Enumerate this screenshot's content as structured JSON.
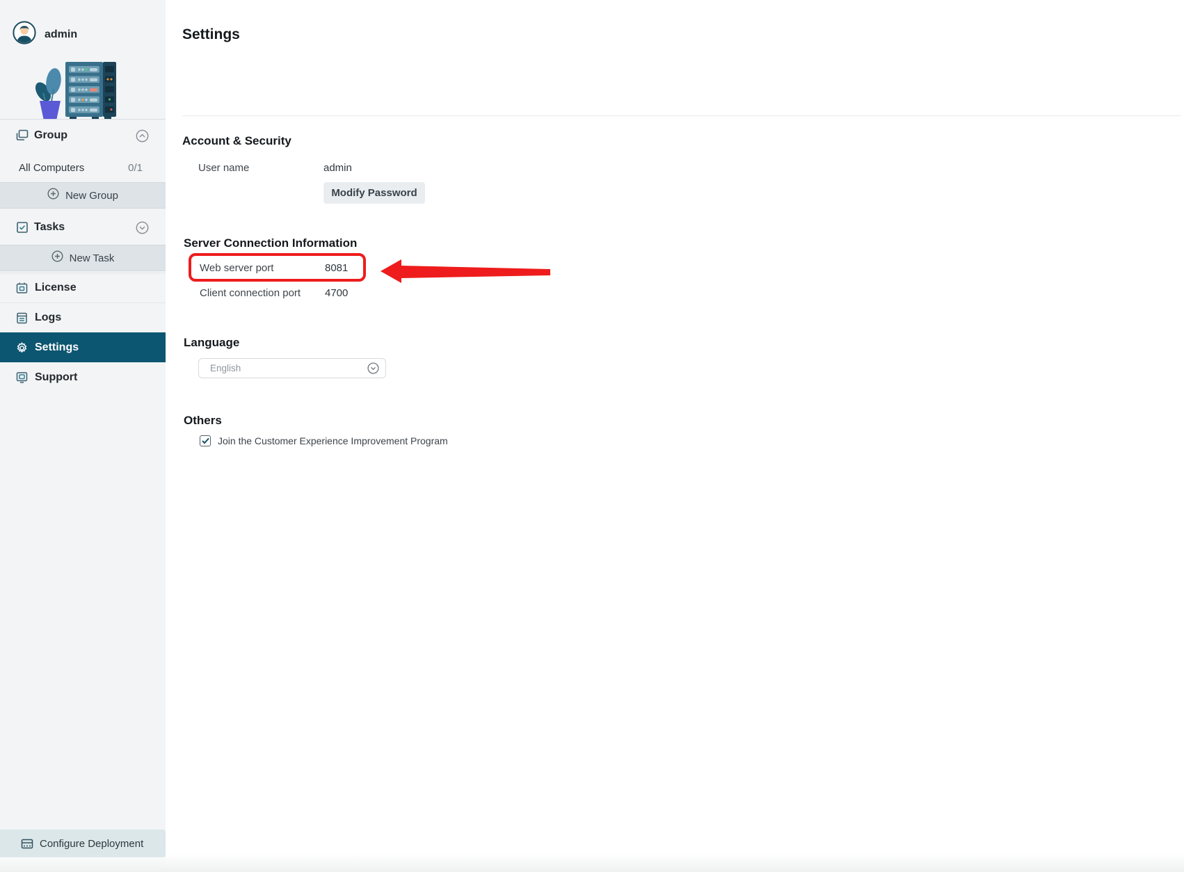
{
  "sidebar": {
    "user": {
      "name": "admin"
    },
    "group_section": {
      "label": "Group",
      "all_computers_label": "All Computers",
      "all_computers_count": "0/1",
      "new_group_label": "New Group"
    },
    "tasks_section": {
      "label": "Tasks",
      "new_task_label": "New Task"
    },
    "nav": [
      {
        "label": "License",
        "selected": false
      },
      {
        "label": "Logs",
        "selected": false
      },
      {
        "label": "Settings",
        "selected": true
      },
      {
        "label": "Support",
        "selected": false
      }
    ],
    "footer": {
      "label": "Configure Deployment"
    }
  },
  "main": {
    "title": "Settings",
    "account": {
      "heading": "Account & Security",
      "username_label": "User name",
      "username_value": "admin",
      "modify_password_label": "Modify Password"
    },
    "server": {
      "heading": "Server Connection Information",
      "web_port_label": "Web server port",
      "web_port_value": "8081",
      "client_port_label": "Client connection port",
      "client_port_value": "4700"
    },
    "language": {
      "heading": "Language",
      "selected_value": "English"
    },
    "others": {
      "heading": "Others",
      "checkbox_label": "Join the Customer Experience Improvement Program",
      "checkbox_checked": true
    }
  },
  "annotation": {
    "highlight_color": "#ee1c1c",
    "highlighted_field": "Web server port"
  },
  "colors": {
    "sidebar_bg": "#f2f4f6",
    "selected_nav_bg": "#0d5671",
    "band_bg": "#dde3e6",
    "accent_teal": "#2f7c91"
  }
}
